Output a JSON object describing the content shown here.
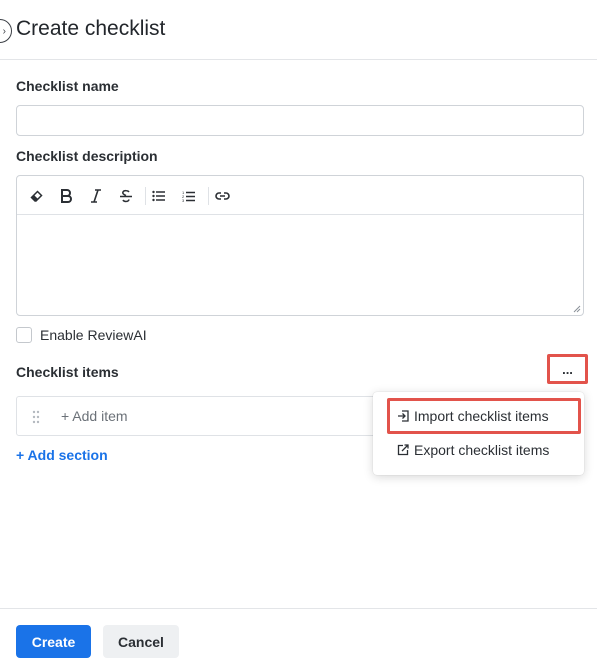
{
  "header": {
    "title": "Create checklist",
    "back_icon": "chevron-right-icon"
  },
  "form": {
    "name_label": "Checklist name",
    "name_value": "",
    "description_label": "Checklist description",
    "toolbar": [
      "eraser-icon",
      "bold-icon",
      "italic-icon",
      "strikethrough-icon",
      "bullet-list-icon",
      "numbered-list-icon",
      "link-icon"
    ],
    "enable_reviewai_label": "Enable ReviewAI",
    "enable_reviewai_checked": false,
    "items_label": "Checklist items",
    "more_label": "...",
    "add_item_label": "+ Add item",
    "add_section_label": "+ Add section"
  },
  "menu": {
    "import_label": "Import checklist items",
    "export_label": "Export checklist items"
  },
  "footer": {
    "create_label": "Create",
    "cancel_label": "Cancel"
  },
  "colors": {
    "accent": "#1a73e8",
    "highlight": "#e2534b"
  }
}
